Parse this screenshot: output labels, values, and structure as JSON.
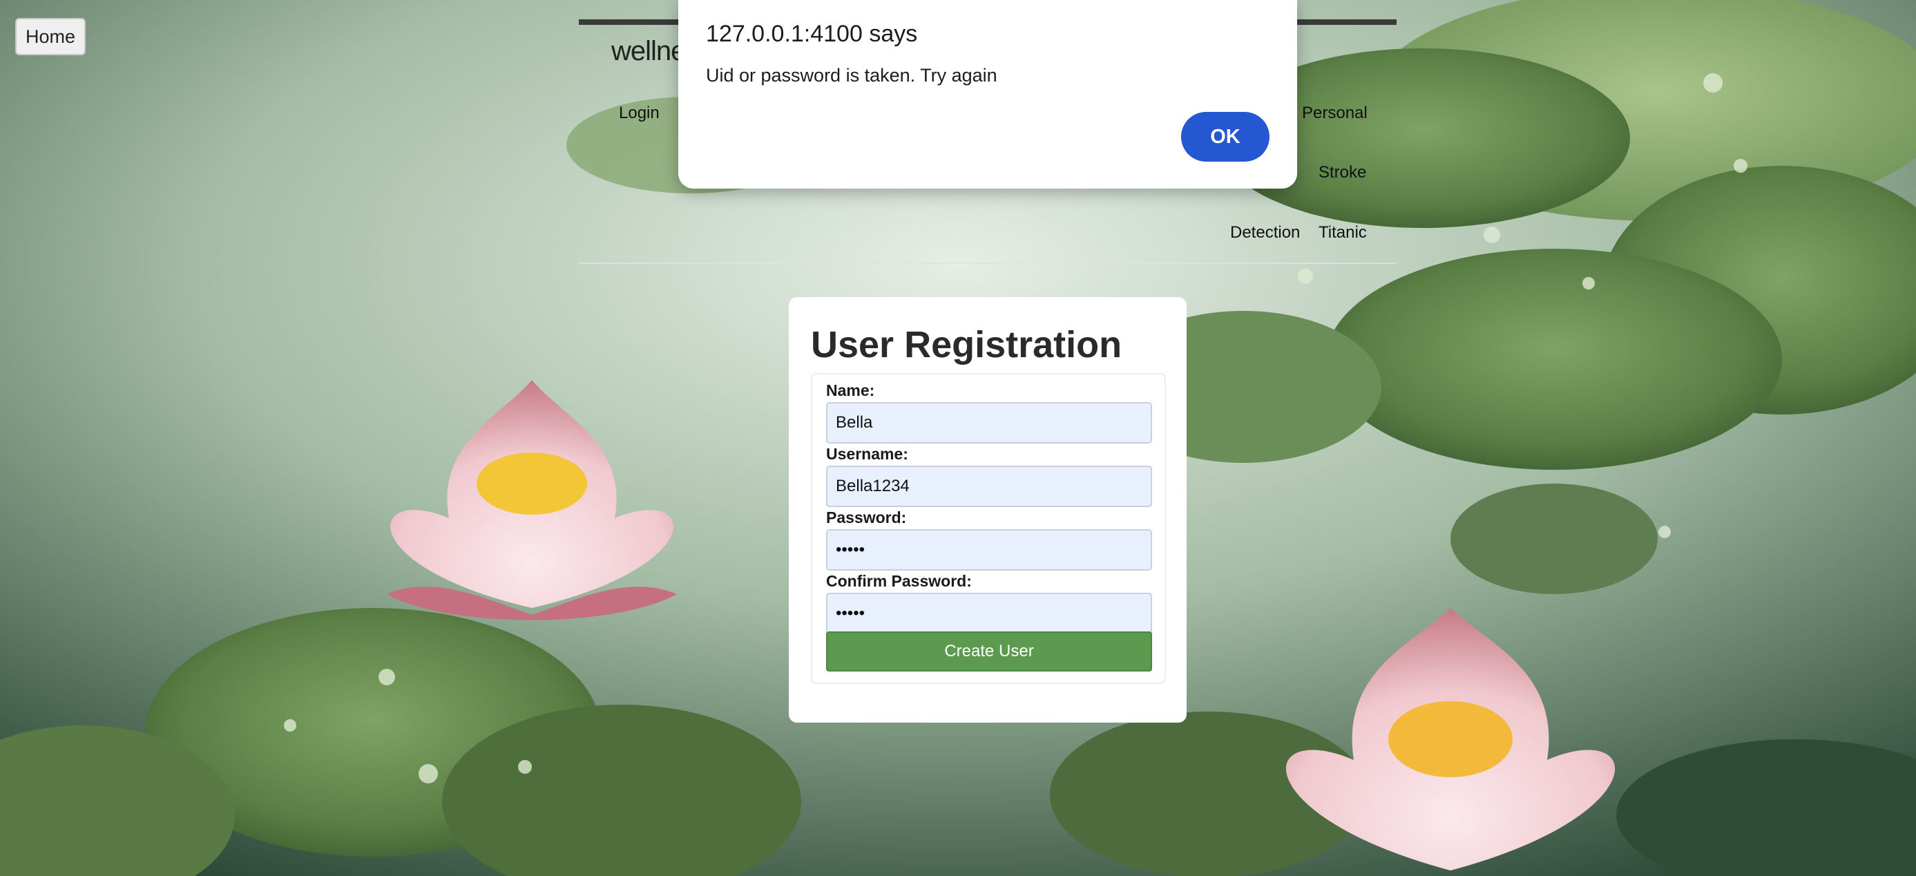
{
  "home_button": {
    "label": "Home"
  },
  "header": {
    "brand_visible": "wellne",
    "nav": {
      "login": "Login",
      "personal": "Personal",
      "stroke": "Stroke",
      "detection": "Detection",
      "titanic": "Titanic"
    }
  },
  "registration": {
    "title": "User Registration",
    "fields": [
      {
        "label": "Name:",
        "value": "Bella"
      },
      {
        "label": "Username:",
        "value": "Bella1234"
      },
      {
        "label": "Password:",
        "value": "•••••"
      },
      {
        "label": "Confirm Password:",
        "value": "•••••"
      }
    ],
    "submit_label": "Create User"
  },
  "alert": {
    "title": "127.0.0.1:4100 says",
    "message": "Uid or password is taken. Try again",
    "ok_label": "OK"
  },
  "colors": {
    "submit_green": "#5b9a4f",
    "ok_blue": "#2457d1",
    "input_bg": "#e8f0fe"
  }
}
